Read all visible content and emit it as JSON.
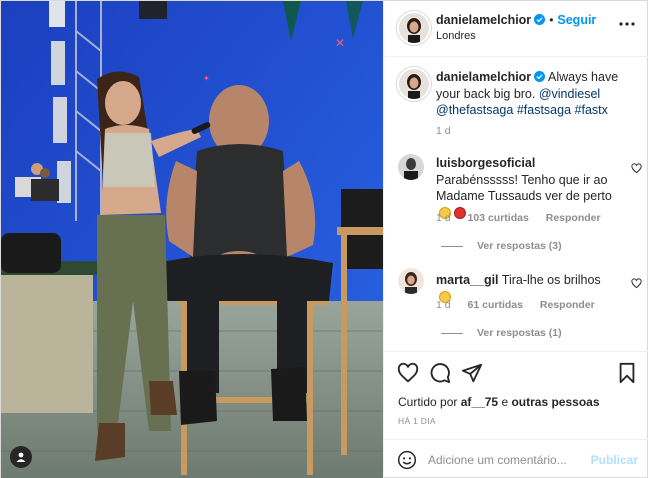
{
  "post": {
    "author": {
      "username": "danielamelchior",
      "follow_label": "Seguir",
      "separator": "•",
      "location": "Londres"
    },
    "caption": {
      "username": "danielamelchior",
      "text": "Always have your back big bro.",
      "mentions": [
        "@vindiesel",
        "@thefastsaga"
      ],
      "hashtags": [
        "#fastsaga",
        "#fastx"
      ],
      "age": "1 d"
    },
    "comments": [
      {
        "username": "luisborgesoficial",
        "text": "Parabénsssss! Tenho que ir ao Madame Tussauds ver de perto",
        "emojis": [
          "grinning-face",
          "smiling-devil"
        ],
        "age": "1 d",
        "likes": "103 curtidas",
        "reply_label": "Responder",
        "view_replies": "Ver respostas (3)"
      },
      {
        "username": "marta__gil",
        "text": "Tira-lhe os brilhos",
        "emojis": [
          "grinning-face"
        ],
        "age": "1 d",
        "likes": "61 curtidas",
        "reply_label": "Responder",
        "view_replies": "Ver respostas (1)"
      }
    ],
    "liked_by": {
      "prefix": "Curtido por",
      "user": "af__75",
      "conjunction": "e",
      "others": "outras pessoas"
    },
    "timestamp": "HÁ 1 DIA",
    "add_comment": {
      "placeholder": "Adicione um comentário...",
      "post_label": "Publicar"
    }
  },
  "icons": {
    "verified": "verified-badge-icon",
    "more": "more-options-icon",
    "like": "heart-icon",
    "comment": "comment-icon",
    "share": "share-icon",
    "save": "bookmark-icon",
    "emoji": "emoji-icon",
    "tags": "user-tag-icon"
  },
  "colors": {
    "accent": "#0095f6",
    "text": "#262626",
    "muted": "#8e8e8e",
    "mention": "#00376b",
    "disabled_accent": "#b2dffc"
  }
}
